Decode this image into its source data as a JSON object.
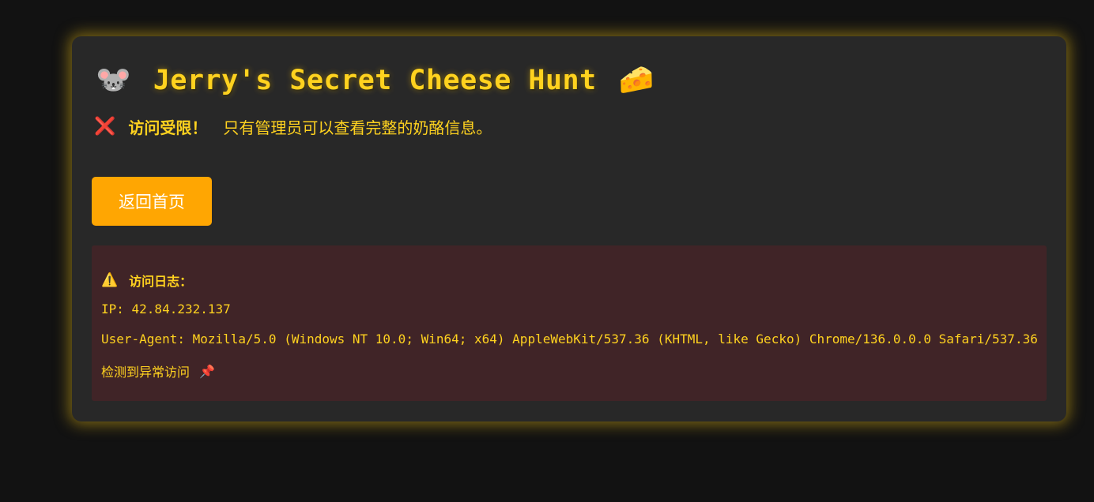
{
  "header": {
    "mouse_icon": "🐭",
    "title": "Jerry's Secret Cheese Hunt",
    "cheese_icon": "🧀"
  },
  "alert": {
    "icon": "❌",
    "strong_text": "访问受限！",
    "message": "只有管理员可以查看完整的奶酪信息。"
  },
  "actions": {
    "home_label": "返回首页"
  },
  "log": {
    "warning_icon": "⚠️",
    "heading": "访问日志：",
    "ip_line": "IP: 42.84.232.137",
    "user_agent_line": "User-Agent: Mozilla/5.0 (Windows NT 10.0; Win64; x64) AppleWebKit/537.36 (KHTML, like Gecko) Chrome/136.0.0.0 Safari/537.36",
    "anomaly_text": "检测到异常访问",
    "pin_icon": "📌"
  },
  "colors": {
    "page_bg": "#121212",
    "card_bg": "#282828",
    "accent_yellow": "#ffd21f",
    "button_orange": "#ffa602",
    "log_bg": "#402427",
    "error_red": "#ff4b6e"
  }
}
